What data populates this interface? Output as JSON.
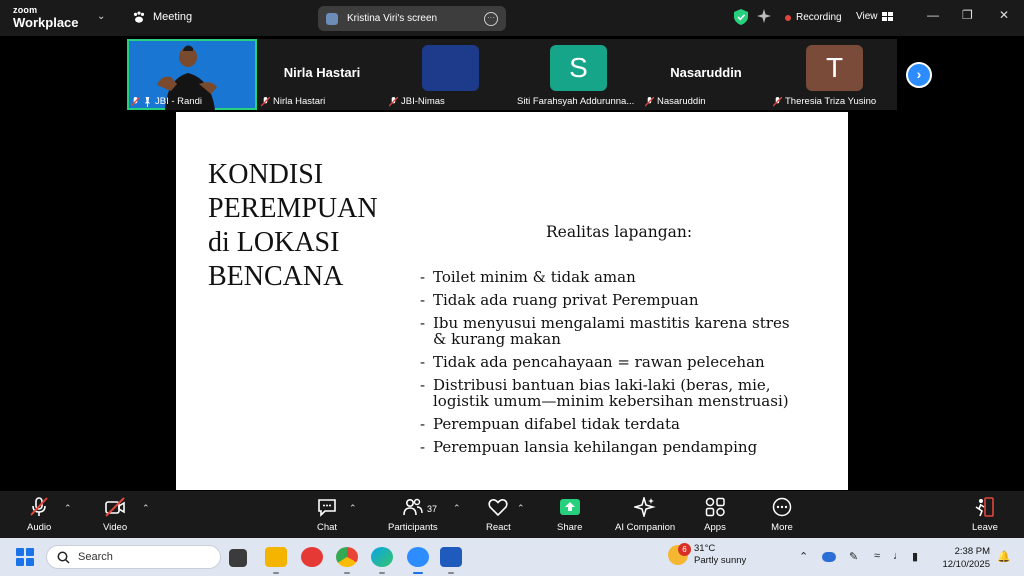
{
  "topbar": {
    "logo_line1": "zoom",
    "logo_line2": "Workplace",
    "meeting_label": "Meeting",
    "share_label": "Kristina Viri's screen",
    "recording_label": "Recording",
    "view_label": "View"
  },
  "participants": [
    {
      "name": "JBI - Randi",
      "display": "",
      "active": true
    },
    {
      "name": "Nirla Hastari",
      "display": "Nirla Hastari"
    },
    {
      "name": "JBI-Nimas",
      "display": ""
    },
    {
      "name": "Siti Farahsyah Addurunna...",
      "display": "S"
    },
    {
      "name": "Nasaruddin",
      "display": "Nasaruddin"
    },
    {
      "name": "Theresia Triza Yusino",
      "display": "T"
    }
  ],
  "slide": {
    "title_lines": [
      "KONDISI",
      "PEREMPUAN",
      "di LOKASI",
      "BENCANA"
    ],
    "subtitle": "Realitas lapangan:",
    "bullets": [
      "Toilet minim & tidak aman",
      "Tidak ada ruang privat Perempuan",
      "Ibu menyusui mengalami mastitis karena stres & kurang makan",
      "Tidak ada pencahayaan = rawan pelecehan",
      "Distribusi bantuan bias laki-laki (beras, mie, logistik umum—minim kebersihan menstruasi)",
      "Perempuan difabel tidak terdata",
      "Perempuan lansia kehilangan pendamping"
    ]
  },
  "toolbar": {
    "audio": "Audio",
    "video": "Video",
    "chat": "Chat",
    "participants": "Participants",
    "participant_count": "37",
    "react": "React",
    "share": "Share",
    "ai_companion": "AI Companion",
    "apps": "Apps",
    "more": "More",
    "leave": "Leave"
  },
  "taskbar": {
    "search_placeholder": "Search",
    "weather_badge": "6",
    "temperature": "31°C",
    "condition": "Partly sunny",
    "time": "2:38 PM",
    "date": "12/10/2025"
  },
  "colors": {
    "accent": "#2d8cff",
    "active_border": "#26d07c",
    "share_green": "#26d07c",
    "record_red": "#e0463c",
    "muted_red": "#e0463c"
  }
}
